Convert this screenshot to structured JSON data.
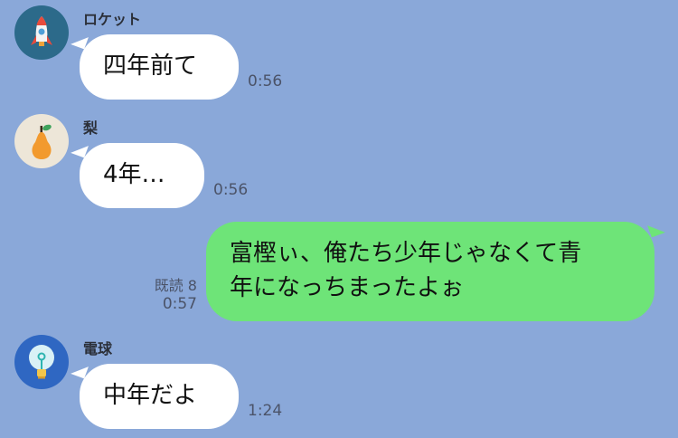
{
  "colors": {
    "background": "#8aa8d9",
    "incoming_bubble": "#ffffff",
    "outgoing_bubble": "#6ee478",
    "rocket_avatar_bg": "#2c6a8a",
    "pear_avatar_bg": "#ede6d8",
    "bulb_avatar_bg": "#2f67c2"
  },
  "messages": [
    {
      "sender": "ロケット",
      "avatar_icon": "rocket-icon",
      "text": "四年前て",
      "time": "0:56"
    },
    {
      "sender": "梨",
      "avatar_icon": "pear-icon",
      "text": "4年…",
      "time": "0:56"
    },
    {
      "direction": "outgoing",
      "read": "既読 8",
      "line1": "富樫ぃ、俺たち少年じゃなくて青",
      "line2": "年になっちまったよぉ",
      "time": "0:57"
    },
    {
      "sender": "電球",
      "avatar_icon": "lightbulb-icon",
      "text": "中年だよ",
      "time": "1:24"
    }
  ]
}
